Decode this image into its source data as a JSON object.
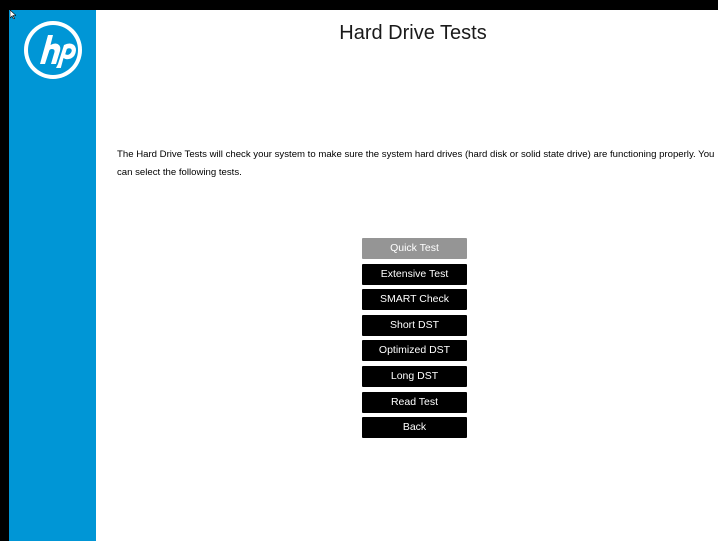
{
  "window": {
    "title": "Hard Drive Tests"
  },
  "brand": {
    "logo_text": "hp",
    "sidebar_color": "#0096d6"
  },
  "main": {
    "description": "The Hard Drive Tests will check your system to make sure the system hard drives (hard disk or solid state drive) are functioning properly. You can select the following tests."
  },
  "tests": [
    {
      "label": "Quick Test",
      "state": "selected"
    },
    {
      "label": "Extensive Test",
      "state": "default"
    },
    {
      "label": "SMART Check",
      "state": "default"
    },
    {
      "label": "Short DST",
      "state": "default"
    },
    {
      "label": "Optimized DST",
      "state": "default"
    },
    {
      "label": "Long DST",
      "state": "default"
    },
    {
      "label": "Read Test",
      "state": "default"
    },
    {
      "label": "Back",
      "state": "default"
    }
  ],
  "colors": {
    "selected_button": "#959595",
    "button": "#000000",
    "button_text": "#ffffff",
    "background": "#ffffff"
  },
  "icons": {
    "logo": "hp-logo-icon",
    "pointer": "mouse-pointer-icon"
  }
}
